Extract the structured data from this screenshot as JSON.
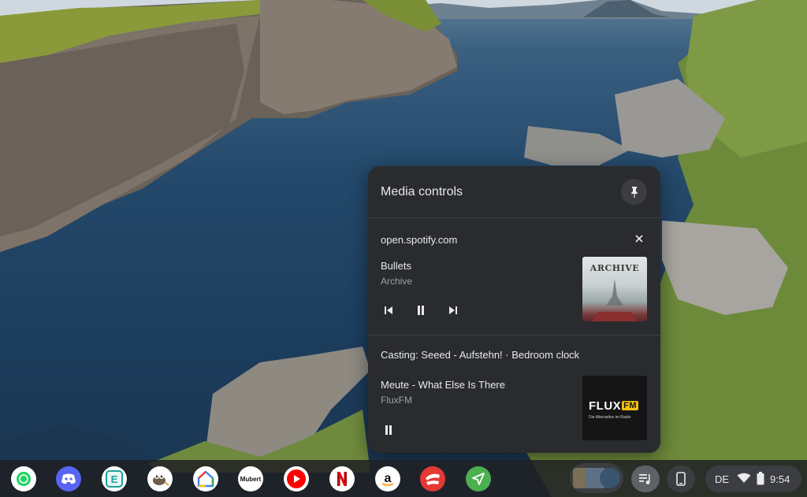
{
  "panel": {
    "title": "Media controls",
    "items": [
      {
        "source": "open.spotify.com",
        "track": "Bullets",
        "artist": "Archive",
        "art_label": "ARCHIVE"
      },
      {
        "casting": "Casting: Seeed - Aufstehn! · Bedroom clock",
        "track": "Meute - What Else Is There",
        "artist": "FluxFM",
        "art_logo": "FLUX",
        "art_logo_badge": "FM",
        "art_tagline": "Die Alternative im Radio"
      }
    ]
  },
  "shelf": {
    "apps": [
      {
        "name": "WhatsApp",
        "icon": "whatsapp-icon"
      },
      {
        "name": "Discord",
        "icon": "discord-icon"
      },
      {
        "name": "E app",
        "icon": "e-app-icon",
        "letter": "E"
      },
      {
        "name": "Gimp",
        "icon": "gimp-icon"
      },
      {
        "name": "Google Home",
        "icon": "google-home-icon"
      },
      {
        "name": "Mubert",
        "icon": "mubert-icon",
        "label": "Mubert"
      },
      {
        "name": "YouTube",
        "icon": "youtube-icon"
      },
      {
        "name": "Netflix",
        "icon": "netflix-icon",
        "letter": "N"
      },
      {
        "name": "Amazon",
        "icon": "amazon-icon",
        "letter": "a"
      },
      {
        "name": "Stadia",
        "icon": "stadia-icon"
      },
      {
        "name": "Direct send",
        "icon": "send-icon"
      }
    ],
    "status": {
      "language": "DE",
      "time": "9:54"
    }
  },
  "colors": {
    "panel_bg": "#2a2b2e",
    "shelf_bg": "#202124",
    "text_primary": "#e8eaed",
    "text_secondary": "#9aa0a6",
    "flux_yellow": "#f2c30f"
  }
}
